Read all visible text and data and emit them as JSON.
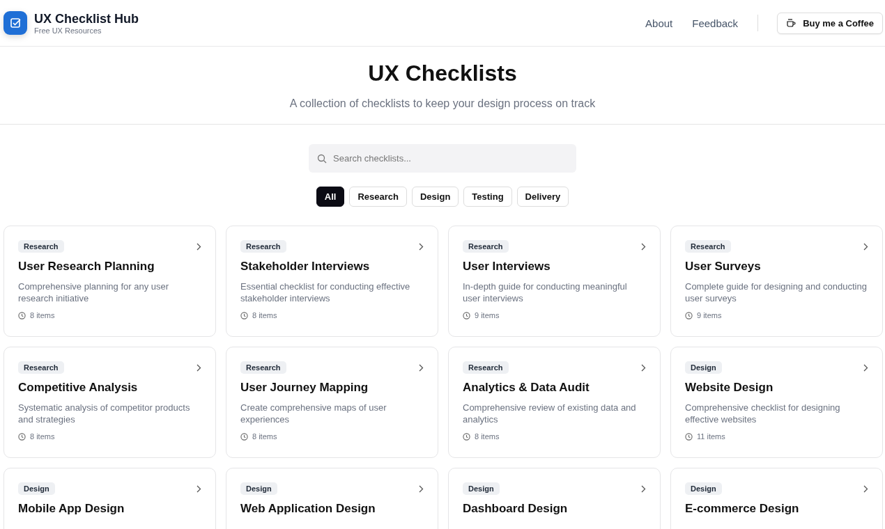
{
  "header": {
    "brand": "UX Checklist Hub",
    "tagline": "Free UX Resources",
    "nav": [
      "About",
      "Feedback"
    ],
    "cta": "Buy me a Coffee"
  },
  "hero": {
    "title": "UX Checklists",
    "subtitle": "A collection of checklists to keep your design process on track"
  },
  "search": {
    "placeholder": "Search checklists..."
  },
  "filters": [
    {
      "label": "All",
      "selected": true
    },
    {
      "label": "Research",
      "selected": false
    },
    {
      "label": "Design",
      "selected": false
    },
    {
      "label": "Testing",
      "selected": false
    },
    {
      "label": "Delivery",
      "selected": false
    }
  ],
  "cards": [
    {
      "tag": "Research",
      "title": "User Research Planning",
      "description": "Comprehensive planning for any user research initiative",
      "count": "8 items"
    },
    {
      "tag": "Research",
      "title": "Stakeholder Interviews",
      "description": "Essential checklist for conducting effective stakeholder interviews",
      "count": "8 items"
    },
    {
      "tag": "Research",
      "title": "User Interviews",
      "description": "In-depth guide for conducting meaningful user interviews",
      "count": "9 items"
    },
    {
      "tag": "Research",
      "title": "User Surveys",
      "description": "Complete guide for designing and conducting user surveys",
      "count": "9 items"
    },
    {
      "tag": "Research",
      "title": "Competitive Analysis",
      "description": "Systematic analysis of competitor products and strategies",
      "count": "8 items"
    },
    {
      "tag": "Research",
      "title": "User Journey Mapping",
      "description": "Create comprehensive maps of user experiences",
      "count": "8 items"
    },
    {
      "tag": "Research",
      "title": "Analytics & Data Audit",
      "description": "Comprehensive review of existing data and analytics",
      "count": "8 items"
    },
    {
      "tag": "Design",
      "title": "Website Design",
      "description": "Comprehensive checklist for designing effective websites",
      "count": "11 items"
    },
    {
      "tag": "Design",
      "title": "Mobile App Design"
    },
    {
      "tag": "Design",
      "title": "Web Application Design"
    },
    {
      "tag": "Design",
      "title": "Dashboard Design"
    },
    {
      "tag": "Design",
      "title": "E-commerce Design"
    }
  ]
}
